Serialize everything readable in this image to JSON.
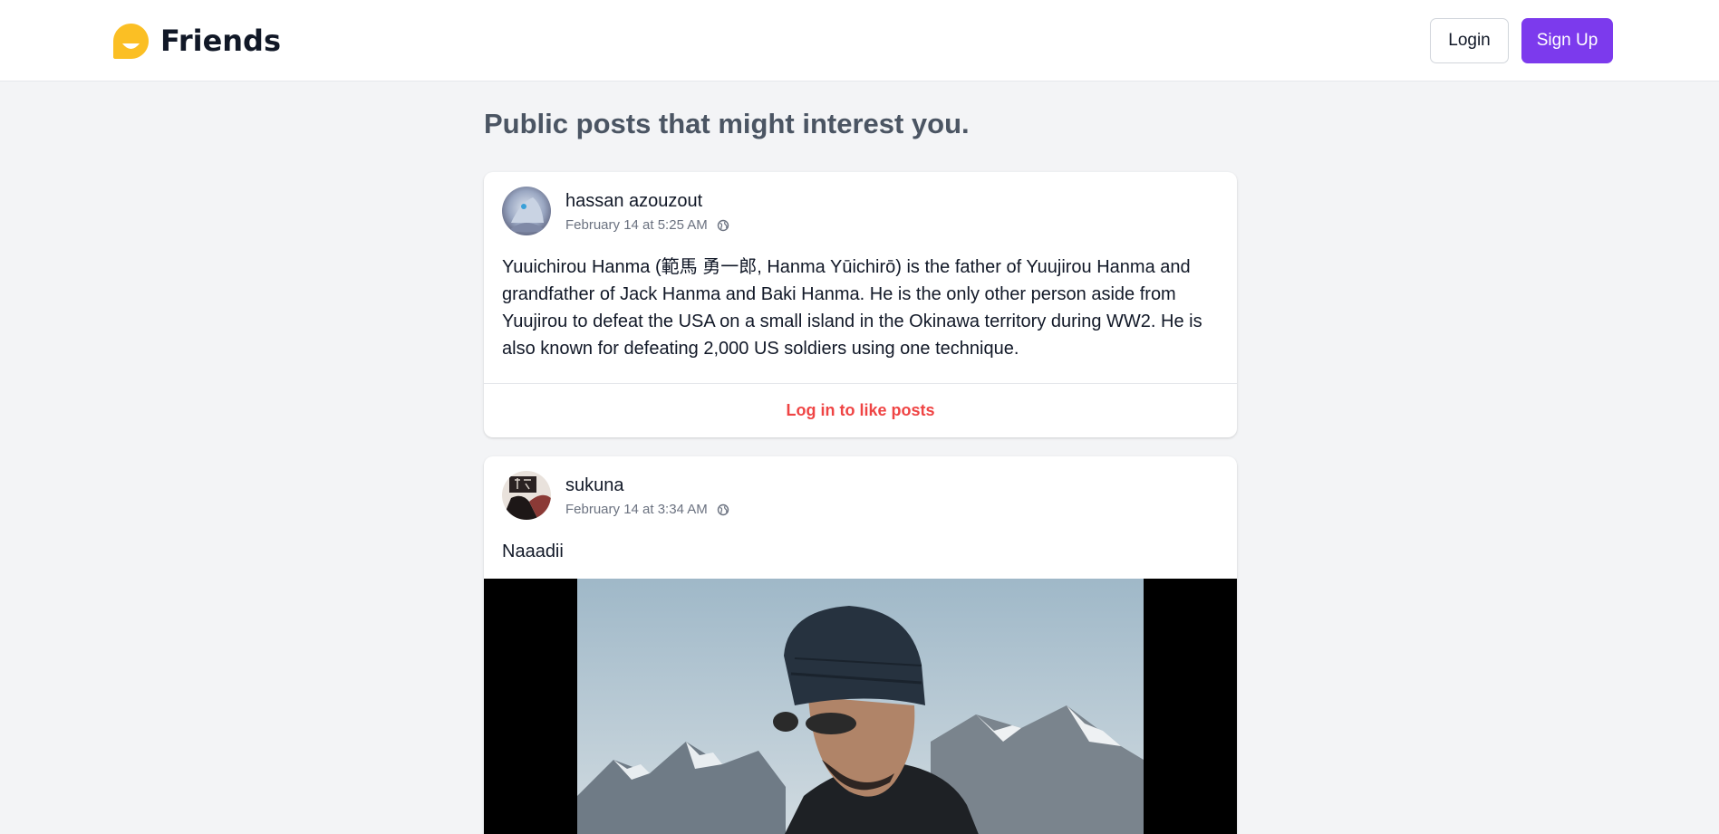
{
  "brand": {
    "name": "Friends",
    "icon": "chat-bubble-smile-icon",
    "icon_color": "#fbbf24"
  },
  "header": {
    "login_label": "Login",
    "signup_label": "Sign Up",
    "accent": "#7c3aed"
  },
  "feed": {
    "heading": "Public posts that might interest you.",
    "posts": [
      {
        "author": "hassan azouzout",
        "timestamp": "February 14 at 5:25 AM",
        "visibility_icon": "globe-icon",
        "text": "Yuuichirou Hanma (範馬 勇一郎, Hanma Yūichirō) is the father of Yuujirou Hanma and grandfather of Jack Hanma and Baki Hanma. He is the only other person aside from Yuujirou to defeat the USA on a small island in the Okinawa territory during WW2. He is also known for defeating 2,000 US soldiers using one technique.",
        "like_prompt": "Log in to like posts"
      },
      {
        "author": "sukuna",
        "timestamp": "February 14 at 3:34 AM",
        "visibility_icon": "globe-icon",
        "text": "Naaadii",
        "image": "man-in-beanie-mountains-photo"
      }
    ]
  },
  "colors": {
    "like_prompt": "#ef4444",
    "heading": "#4b5563",
    "background": "#f3f4f6"
  }
}
